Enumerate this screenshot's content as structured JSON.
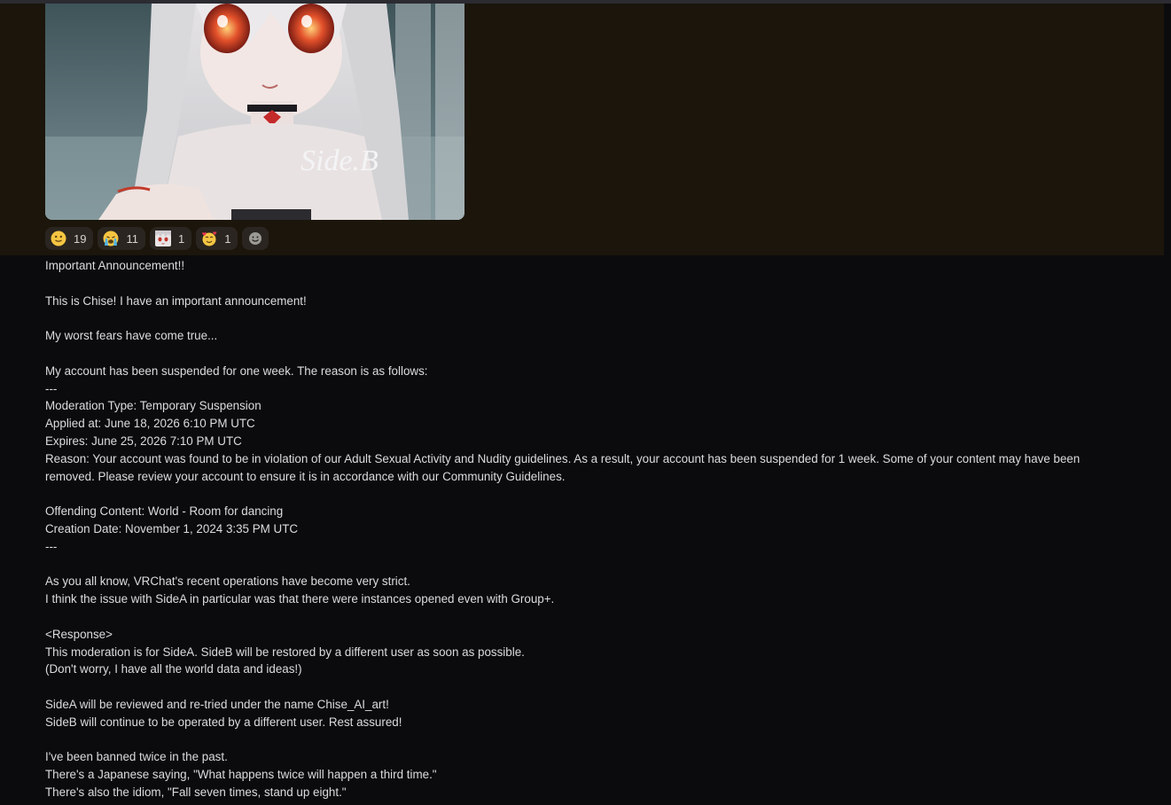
{
  "attachment": {
    "watermark": "Side.B"
  },
  "reactions": [
    {
      "icon": "slight-smile-emoji-icon",
      "count": "19"
    },
    {
      "icon": "crying-emoji-icon",
      "count": "11"
    },
    {
      "icon": "custom-avatar-emoji-icon",
      "count": "1"
    },
    {
      "icon": "smiling-hearts-emoji-icon",
      "count": "1"
    }
  ],
  "add_reaction_icon": "add-reaction-icon",
  "colors": {
    "background": "#0b0b0e",
    "highlight": "#1b150b",
    "reaction_pill": "#2a2520",
    "text": "#dcdcdf"
  },
  "message": {
    "lines": [
      "Important Announcement!!",
      "",
      "This is Chise! I have an important announcement!",
      "",
      "My worst fears have come true...",
      "",
      "My account has been suspended for one week. The reason is as follows:",
      "---",
      "Moderation Type: Temporary Suspension",
      "Applied at: June 18, 2026 6:10 PM UTC",
      "Expires: June 25, 2026 7:10 PM UTC",
      "Reason: Your account was found to be in violation of our Adult Sexual Activity and Nudity guidelines. As a result, your account has been suspended for 1 week. Some of your content may have been removed. Please review your account to ensure it is in accordance with our Community Guidelines.",
      "",
      "Offending Content: World - Room for dancing",
      "Creation Date: November 1, 2024 3:35 PM UTC",
      "---",
      "",
      "As you all know, VRChat's recent operations have become very strict.",
      "I think the issue with SideA in particular was that there were instances opened even with Group+.",
      "",
      "<Response>",
      "This moderation is for SideA. SideB will be restored by a different user as soon as possible.",
      "(Don't worry, I have all the world data and ideas!)",
      "",
      "SideA will be reviewed and re-tried under the name Chise_AI_art!",
      "SideB will continue to be operated by a different user. Rest assured!",
      "",
      "I've been banned twice in the past.",
      "There's a Japanese saying, \"What happens twice will happen a third time.\"",
      "There's also the idiom, \"Fall seven times, stand up eight.\""
    ]
  }
}
